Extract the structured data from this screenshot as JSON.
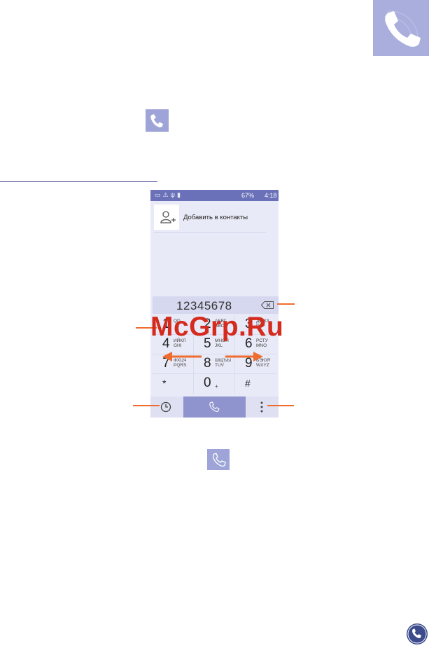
{
  "statusbar": {
    "battery": "67%",
    "time": "4:18"
  },
  "dialer": {
    "add_contact_label": "Добавить в контакты",
    "number_display": "12345678",
    "keys": [
      {
        "digit": "1",
        "letters": "QD"
      },
      {
        "digit": "2",
        "letters": "АБВГ\nABC"
      },
      {
        "digit": "3",
        "letters": "ДЕЖЗ\nDEF"
      },
      {
        "digit": "4",
        "letters": "ИЙКЛ\nGHI"
      },
      {
        "digit": "5",
        "letters": "МНОП\nJKL"
      },
      {
        "digit": "6",
        "letters": "РСТУ\nMNO"
      },
      {
        "digit": "7",
        "letters": "ФХЦЧ\nPQRS"
      },
      {
        "digit": "8",
        "letters": "ШЩЪЫ\nTUV"
      },
      {
        "digit": "9",
        "letters": "ЬЭЮЯ\nWXYZ"
      },
      {
        "digit": "*",
        "letters": ""
      },
      {
        "digit": "0",
        "letters": "+"
      },
      {
        "digit": "#",
        "letters": ""
      }
    ]
  },
  "watermark": "McGrp.Ru",
  "colors": {
    "accent": "#8f94cf",
    "callout": "#ef6c2f",
    "statusbar": "#6a71b8",
    "watermark": "#d52b1e"
  }
}
